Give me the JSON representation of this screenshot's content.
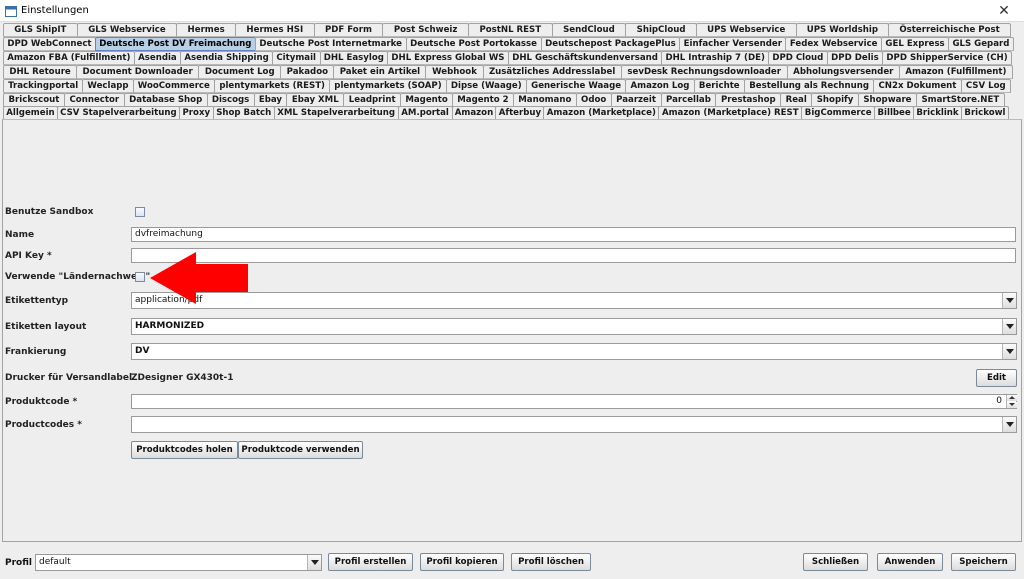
{
  "window": {
    "title": "Einstellungen",
    "close_glyph": "✕",
    "icon": "app-window-icon"
  },
  "tab_rows": [
    [
      "GLS ShipIT",
      "GLS Webservice",
      "Hermes",
      "Hermes HSI",
      "PDF Form",
      "Post Schweiz",
      "PostNL REST",
      "SendCloud",
      "ShipCloud",
      "UPS Webservice",
      "UPS Worldship",
      "Österreichische Post"
    ],
    [
      "DPD WebConnect",
      "Deutsche Post DV Freimachung",
      "Deutsche Post Internetmarke",
      "Deutsche Post Portokasse",
      "Deutschepost PackagePlus",
      "Einfacher Versender",
      "Fedex Webservice",
      "GEL Express",
      "GLS Gepard"
    ],
    [
      "Amazon FBA (Fulfillment)",
      "Asendia",
      "Asendia Shipping",
      "Citymail",
      "DHL Easylog",
      "DHL Express Global WS",
      "DHL Geschäftskundenversand",
      "DHL Intraship 7 (DE)",
      "DPD Cloud",
      "DPD Delis",
      "DPD ShipperService (CH)"
    ],
    [
      "DHL Retoure",
      "Document Downloader",
      "Document Log",
      "Pakadoo",
      "Paket ein Artikel",
      "Webhook",
      "Zusätzliches Addresslabel",
      "sevDesk Rechnungsdownloader",
      "Abholungsversender",
      "Amazon (Fulfillment)"
    ],
    [
      "Trackingportal",
      "Weclapp",
      "WooCommerce",
      "plentymarkets (REST)",
      "plentymarkets (SOAP)",
      "Dipse (Waage)",
      "Generische Waage",
      "Amazon Log",
      "Berichte",
      "Bestellung als Rechnung",
      "CN2x Dokument",
      "CSV Log"
    ],
    [
      "Brickscout",
      "Connector",
      "Database Shop",
      "Discogs",
      "Ebay",
      "Ebay XML",
      "Leadprint",
      "Magento",
      "Magento 2",
      "Manomano",
      "Odoo",
      "Paarzeit",
      "Parcellab",
      "Prestashop",
      "Real",
      "Shopify",
      "Shopware",
      "SmartStore.NET"
    ],
    [
      "Allgemein",
      "CSV Stapelverarbeitung",
      "Proxy",
      "Shop Batch",
      "XML Stapelverarbeitung",
      "AM.portal",
      "Amazon",
      "Afterbuy",
      "Amazon (Marketplace)",
      "Amazon (Marketplace) REST",
      "BigCommerce",
      "Billbee",
      "Bricklink",
      "Brickowl"
    ]
  ],
  "selected_tab": "Deutsche Post DV Freimachung",
  "form": {
    "sandbox_label": "Benutze Sandbox",
    "name_label": "Name",
    "name_value": "dvfreimachung",
    "apikey_label": "API Key *",
    "apikey_value": "",
    "laendernachweis_label": "Verwende \"Ländernachweis\"",
    "etikettentyp_label": "Etikettentyp",
    "etikettentyp_value": "application/pdf",
    "layout_label": "Etiketten layout",
    "layout_value": "HARMONIZED",
    "frankierung_label": "Frankierung",
    "frankierung_value": "DV",
    "drucker_label": "Drucker für Versandlabel",
    "drucker_value": "ZDesigner GX430t-1",
    "edit_button": "Edit",
    "produktcode_label": "Produktcode *",
    "produktcode_value": "0",
    "productcodes_label": "Productcodes *",
    "productcodes_value": "",
    "holen_button": "Produktcodes holen",
    "verwenden_button": "Produktcode verwenden"
  },
  "annotation": {
    "arrow_color": "#ff0000"
  },
  "bottom": {
    "profile_label": "Profil",
    "profile_value": "default",
    "create_button": "Profil erstellen",
    "copy_button": "Profil kopieren",
    "delete_button": "Profil löschen",
    "close_button": "Schließen",
    "apply_button": "Anwenden",
    "save_button": "Speichern"
  }
}
